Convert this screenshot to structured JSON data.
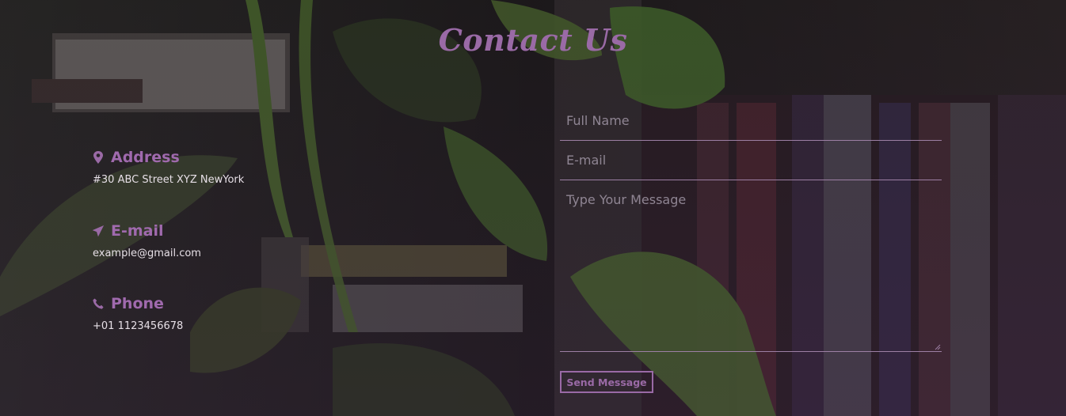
{
  "page": {
    "title": "Contact Us"
  },
  "info": [
    {
      "label": "Address",
      "value": "#30 ABC Street XYZ NewYork",
      "icon": "map-pin-icon"
    },
    {
      "label": "E-mail",
      "value": "example@gmail.com",
      "icon": "paper-plane-icon"
    },
    {
      "label": "Phone",
      "value": "+01 1123456678",
      "icon": "phone-icon"
    }
  ],
  "form": {
    "name_placeholder": "Full Name",
    "email_placeholder": "E-mail",
    "message_placeholder": "Type Your Message",
    "submit_label": "Send Message"
  },
  "colors": {
    "accent": "#9a6aa6",
    "text": "#e6dfe6",
    "placeholder": "#8f8593"
  }
}
